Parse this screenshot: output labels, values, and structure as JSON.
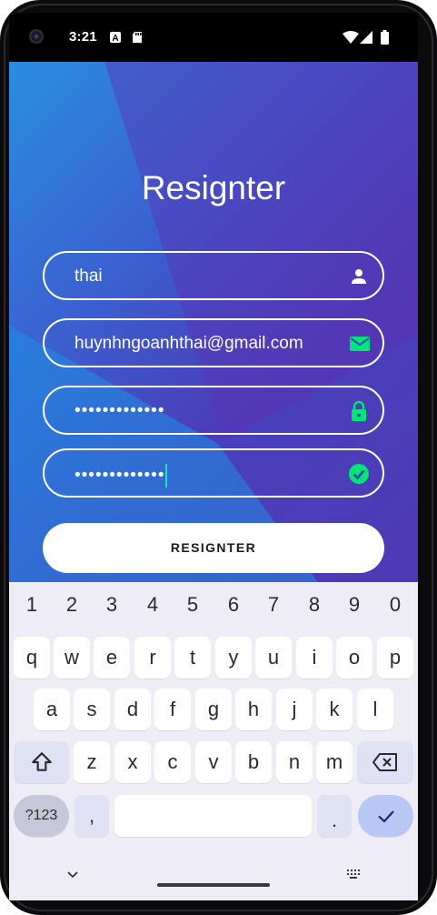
{
  "status_bar": {
    "time": "3:21",
    "icons": [
      "camera-cutout",
      "a-badge-icon",
      "sd-card-icon",
      "wifi-icon",
      "signal-icon",
      "battery-icon"
    ]
  },
  "form": {
    "title": "Resignter",
    "username": {
      "value": "thai",
      "icon": "person-icon"
    },
    "email": {
      "value": "huynhngoanhthai@gmail.com",
      "icon": "email-icon"
    },
    "password": {
      "value": "•••••••••••••",
      "icon": "lock-icon"
    },
    "confirm_password": {
      "value": "•••••••••••••",
      "icon": "check-circle-icon"
    },
    "submit_label": "RESIGNTER"
  },
  "colors": {
    "icon_accent": "#00e676",
    "gradient_start": "#2a8fe0",
    "gradient_end": "#5a2aa6",
    "caret": "#1de9b6"
  },
  "keyboard": {
    "numbers": [
      "1",
      "2",
      "3",
      "4",
      "5",
      "6",
      "7",
      "8",
      "9",
      "0"
    ],
    "row1": [
      "q",
      "w",
      "e",
      "r",
      "t",
      "y",
      "u",
      "i",
      "o",
      "p"
    ],
    "row2": [
      "a",
      "s",
      "d",
      "f",
      "g",
      "h",
      "j",
      "k",
      "l"
    ],
    "row3": [
      "z",
      "x",
      "c",
      "v",
      "b",
      "n",
      "m"
    ],
    "symbols_label": "?123",
    "comma": ",",
    "period": "."
  }
}
